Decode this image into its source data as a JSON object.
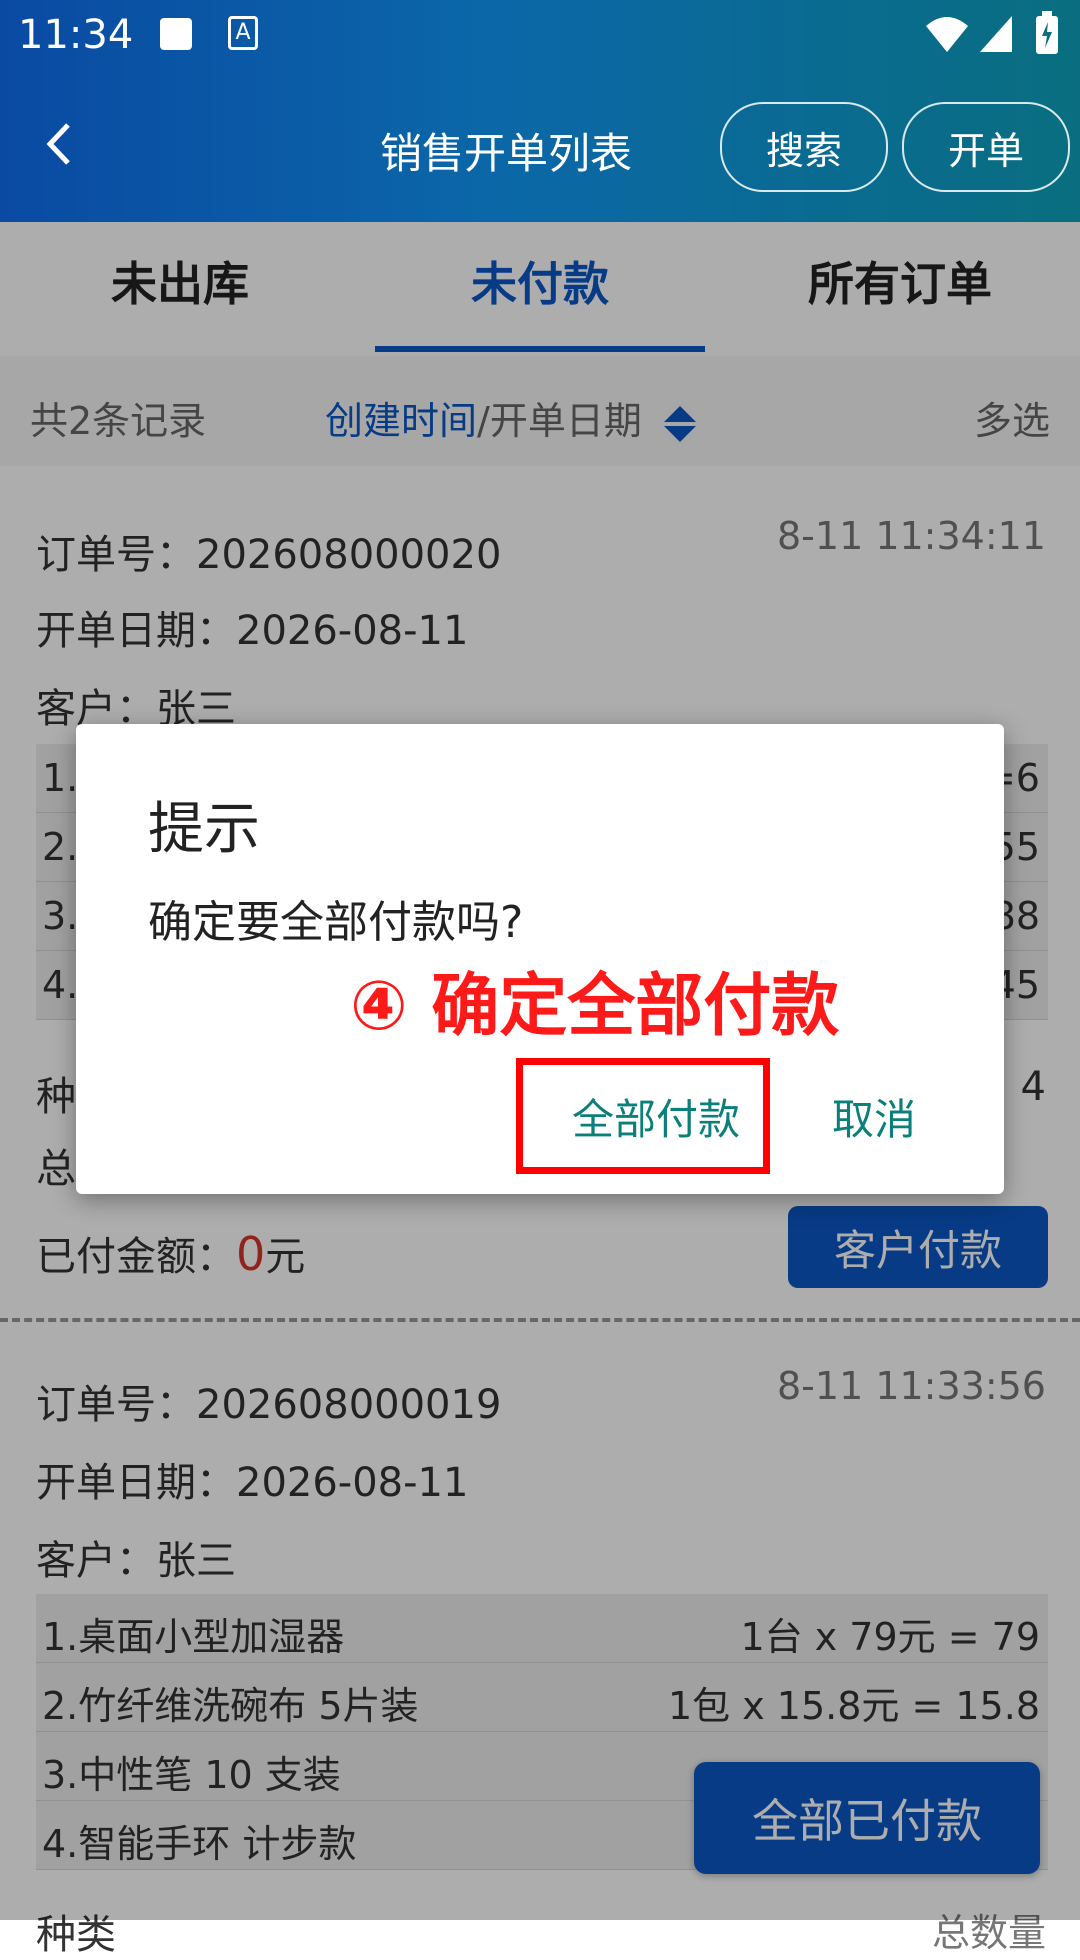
{
  "status_bar": {
    "time": "11:34"
  },
  "header": {
    "back_icon": "chevron-left-icon",
    "title": "销售开单列表",
    "search_label": "搜索",
    "create_label": "开单"
  },
  "tabs": [
    {
      "label": "未出库",
      "active": false
    },
    {
      "label": "未付款",
      "active": true
    },
    {
      "label": "所有订单",
      "active": false
    }
  ],
  "sortbar": {
    "count": "共2条记录",
    "sort_active": "创建时间",
    "sort_sep": "/开单日期",
    "multi": "多选"
  },
  "orders": [
    {
      "order_no": "订单号：202608000020",
      "date": "开单日期：2026-08-11",
      "customer": "客户：张三",
      "time": "8-11 11:34:11",
      "items": [
        {
          "name": "1.",
          "calc": "=6"
        },
        {
          "name": "2.",
          "calc": "55"
        },
        {
          "name": "3.",
          "calc": "88"
        },
        {
          "name": "4.",
          "calc": "45"
        }
      ],
      "kinds_prefix": "种",
      "kinds_value": "4",
      "total_prefix": "总",
      "paid_label": "已付金额：",
      "paid_value": "0",
      "paid_unit": "元",
      "pay_button": "客户付款"
    },
    {
      "order_no": "订单号：202608000019",
      "date": "开单日期：2026-08-11",
      "customer": "客户：张三",
      "time": "8-11 11:33:56",
      "items": [
        {
          "name": "1.桌面小型加湿器",
          "calc": "1台 x 79元 = 79"
        },
        {
          "name": "2.竹纤维洗碗布 5片装",
          "calc": "1包 x 15.8元 = 15.8"
        },
        {
          "name": "3.中性笔 10 支装",
          "calc": ""
        },
        {
          "name": "4.智能手环 计步款",
          "calc": ""
        }
      ],
      "bottom_left": "种类",
      "bottom_right": "总数量"
    }
  ],
  "dialog": {
    "title": "提示",
    "message": "确定要全部付款吗?",
    "confirm": "全部付款",
    "cancel": "取消"
  },
  "annotation": "④ 确定全部付款",
  "bottom_button": "全部已付款",
  "colors": {
    "primary": "#0b57c4",
    "accent": "#0b7f7a",
    "annotation": "#ff0000",
    "paid_zero": "#d8342a"
  }
}
